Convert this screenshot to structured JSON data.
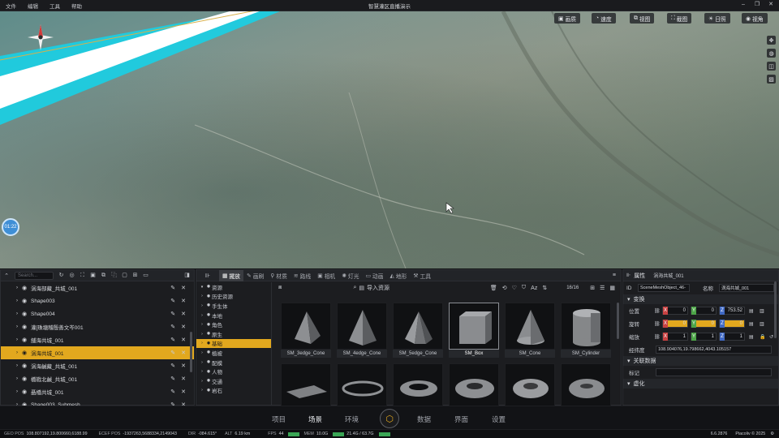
{
  "window": {
    "title": "智慧灌区直播演示",
    "menu": [
      "文件",
      "编辑",
      "工具",
      "帮助"
    ]
  },
  "viewport": {
    "buttons": [
      {
        "icon": "image-icon",
        "label": "画质"
      },
      {
        "icon": "gauge-icon",
        "label": "速度"
      },
      {
        "icon": "camera-view-icon",
        "label": "视图"
      },
      {
        "icon": "screenshot-icon",
        "label": "截图"
      },
      {
        "icon": "sun-icon",
        "label": "日照"
      },
      {
        "icon": "eye-icon",
        "label": "视角"
      }
    ],
    "timer": "01:22"
  },
  "outliner": {
    "search_placeholder": "Search...",
    "items": [
      {
        "label": "涡海部藏_共城_001",
        "selected": false
      },
      {
        "label": "Shape003",
        "selected": false
      },
      {
        "label": "Shape004",
        "selected": false
      },
      {
        "label": "灌[珠塘稽殷善文岑001",
        "selected": false
      },
      {
        "label": "舖海共城_001",
        "selected": false
      },
      {
        "label": "涡海共城_001",
        "selected": true
      },
      {
        "label": "涡海鹹藏_共城_001",
        "selected": false
      },
      {
        "label": "橋戡北鹹_共城_001",
        "selected": false
      },
      {
        "label": "聶橋共城_001",
        "selected": false
      },
      {
        "label": "Shape003_Submesh",
        "selected": false
      }
    ]
  },
  "assets": {
    "tabs": [
      {
        "label": "擺放",
        "active": true
      },
      {
        "label": "画刷",
        "active": false
      },
      {
        "label": "材质",
        "active": false
      },
      {
        "label": "路线",
        "active": false
      },
      {
        "label": "相机",
        "active": false
      },
      {
        "label": "灯光",
        "active": false
      },
      {
        "label": "动画",
        "active": false
      },
      {
        "label": "地形",
        "active": false
      },
      {
        "label": "工具",
        "active": false
      }
    ],
    "categories": [
      {
        "label": "资源",
        "selected": false
      },
      {
        "label": "历史资源",
        "selected": false
      },
      {
        "label": "手生体",
        "selected": false
      },
      {
        "label": "本地",
        "selected": false
      },
      {
        "label": "角色",
        "selected": false
      },
      {
        "label": "原生",
        "selected": false
      },
      {
        "label": "基础",
        "selected": true
      },
      {
        "label": "植被",
        "selected": false
      },
      {
        "label": "配模",
        "selected": false
      },
      {
        "label": "人物",
        "selected": false
      },
      {
        "label": "交通",
        "selected": false
      },
      {
        "label": "岩石",
        "selected": false
      }
    ],
    "import_label": "导入资源",
    "count": "16/16",
    "items": [
      {
        "label": "SM_3edge_Cone",
        "shape": "pyramid3"
      },
      {
        "label": "SM_4edge_Cone",
        "shape": "pyramid4"
      },
      {
        "label": "SM_5edge_Cone",
        "shape": "pyramid5"
      },
      {
        "label": "SM_Box",
        "shape": "box",
        "selected": true
      },
      {
        "label": "SM_Cone",
        "shape": "cone"
      },
      {
        "label": "SM_Cylinder",
        "shape": "cylinder"
      },
      {
        "label": "",
        "shape": "plane"
      },
      {
        "label": "",
        "shape": "ring"
      },
      {
        "label": "",
        "shape": "torus"
      },
      {
        "label": "",
        "shape": "torus2"
      },
      {
        "label": "",
        "shape": "torus3"
      },
      {
        "label": "",
        "shape": "torus4"
      }
    ]
  },
  "properties": {
    "title": "属性",
    "object_name": "涡海共城_001",
    "id_label": "ID",
    "id_value": "SceneMeshObject_46-",
    "name_label": "名称",
    "name_value": "涡海共城_001",
    "transform_label": "变换",
    "position_label": "位置",
    "position": {
      "x": "0",
      "y": "0",
      "z": "753.52"
    },
    "rotation_label": "旋转",
    "rotation": {
      "x": "0",
      "y": "0",
      "z": "0"
    },
    "scale_label": "缩放",
    "scale": {
      "x": "1",
      "y": "1",
      "z": "1"
    },
    "latlon_label": "经纬度",
    "latlon_value": "108.904076,19.798662,4043.105157",
    "linked_label": "关联数据",
    "tag_label": "标记",
    "virtual_label": "虚化"
  },
  "footer": {
    "nav": [
      "项目",
      "场景",
      "环境",
      "数据",
      "界面",
      "设置"
    ]
  },
  "status": {
    "geo_pos_label": "GEO POS",
    "geo_pos": "108.807192,19.800660,6188.99",
    "ecef_label": "ECEF POS",
    "ecef": "-1937263,5688334,2149043",
    "dir_label": "DIR",
    "dir": "-084.615°",
    "alt_label": "ALT",
    "alt": "6.19 km",
    "fps_label": "FPS",
    "fps": "44",
    "mem_label": "MEM",
    "mem": "10.0G",
    "gpu": "21.4G / 63.7G",
    "version": "6.6.2876",
    "copyright": "Piacoliv © 2025"
  }
}
